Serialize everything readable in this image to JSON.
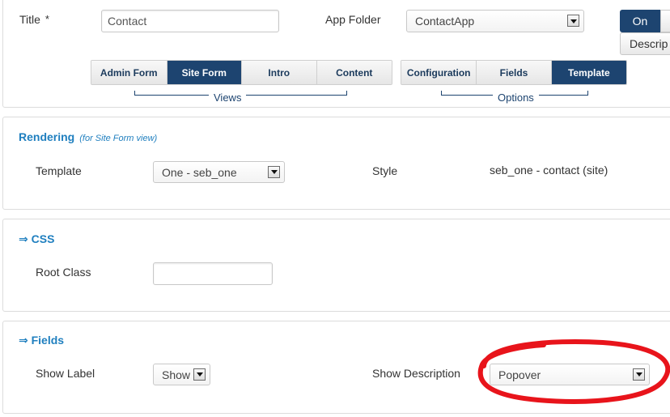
{
  "header": {
    "title_label": "Title",
    "required_mark": "*",
    "title_value": "Contact",
    "app_folder_label": "App Folder",
    "app_folder_value": "ContactApp",
    "on_button": "On",
    "description_button": "Descrip"
  },
  "views_tabs": {
    "items": [
      "Admin Form",
      "Site Form",
      "Intro",
      "Content"
    ],
    "active": "Site Form",
    "group_label": "Views"
  },
  "options_tabs": {
    "items": [
      "Configuration",
      "Fields",
      "Template"
    ],
    "active": "Template",
    "group_label": "Options"
  },
  "rendering": {
    "title": "Rendering",
    "subtitle": "(for Site Form view)",
    "template_label": "Template",
    "template_value": "One - seb_one",
    "style_label": "Style",
    "style_value": "seb_one - contact (site)"
  },
  "css": {
    "title": "⇒ CSS",
    "root_class_label": "Root Class",
    "root_class_value": ""
  },
  "fields": {
    "title": "⇒ Fields",
    "show_label_label": "Show Label",
    "show_label_value": "Show",
    "show_description_label": "Show Description",
    "show_description_value": "Popover"
  },
  "colors": {
    "accent": "#1d4470",
    "section_title": "#1f7fbf",
    "highlight": "#e8141b"
  }
}
